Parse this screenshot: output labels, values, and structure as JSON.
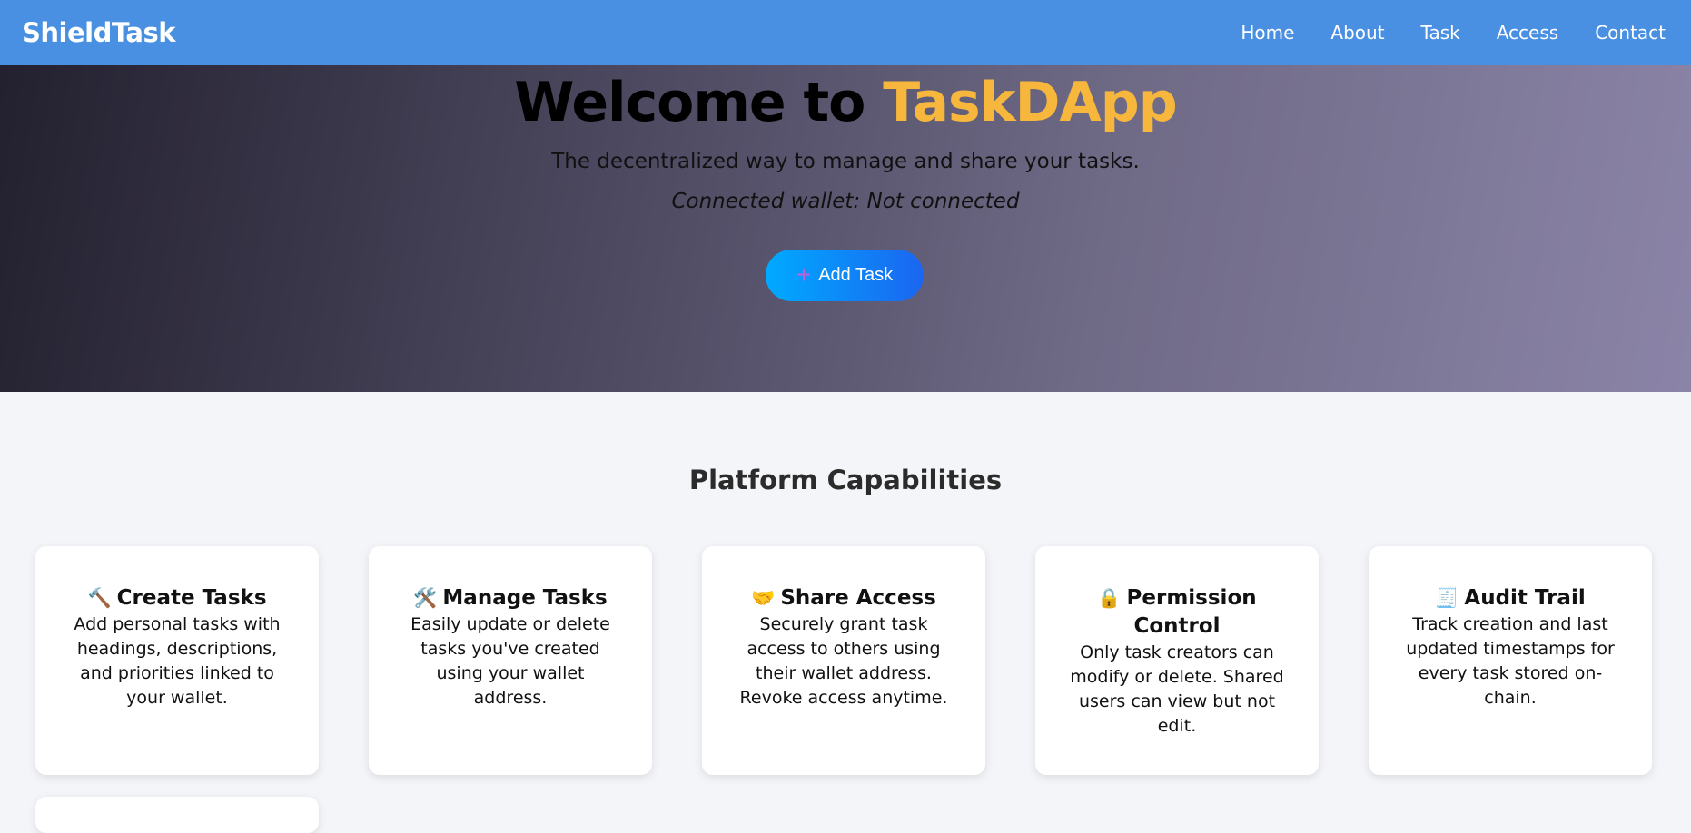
{
  "nav": {
    "brand": "ShieldTask",
    "links": [
      "Home",
      "About",
      "Task",
      "Access",
      "Contact"
    ]
  },
  "hero": {
    "title_prefix": "Welcome to ",
    "title_accent": "TaskDApp",
    "subtitle": "The decentralized way to manage and share your tasks.",
    "wallet_text": "Connected wallet: Not connected",
    "add_button": "Add Task",
    "add_icon": "+"
  },
  "capabilities": {
    "title": "Platform Capabilities",
    "cards": [
      {
        "icon": "🔨",
        "title": "Create Tasks",
        "text": "Add personal tasks with headings, descriptions, and priorities linked to your wallet."
      },
      {
        "icon": "🛠️",
        "title": "Manage Tasks",
        "text": "Easily update or delete tasks you've created using your wallet address."
      },
      {
        "icon": "🤝",
        "title": "Share Access",
        "text": "Securely grant task access to others using their wallet address. Revoke access anytime."
      },
      {
        "icon": "🔒",
        "title": "Permission Control",
        "text": "Only task creators can modify or delete. Shared users can view but not edit."
      },
      {
        "icon": "🧾",
        "title": "Audit Trail",
        "text": "Track creation and last updated timestamps for every task stored on-chain."
      }
    ]
  },
  "colors": {
    "navbar": "#4a90e2",
    "accent": "#f6b73c",
    "button_start": "#00aaff",
    "button_end": "#1b66f0"
  }
}
